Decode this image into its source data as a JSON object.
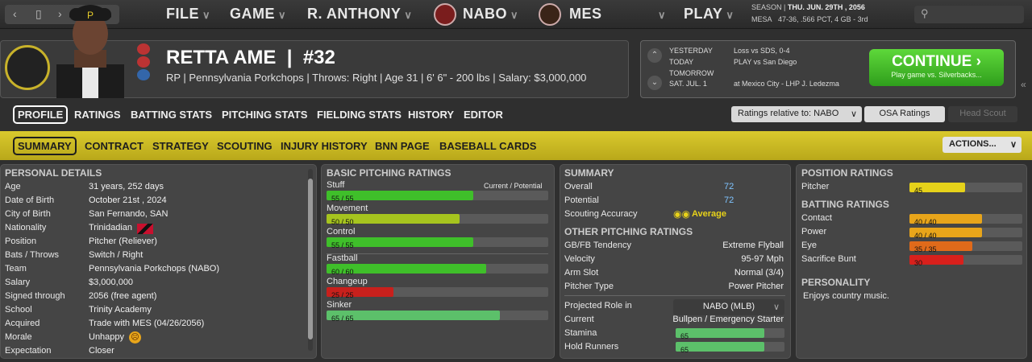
{
  "topbar": {
    "menus": [
      "FILE",
      "GAME",
      "R. ANTHONY",
      "NABO",
      "MES",
      "PLAY"
    ],
    "season_label": "SEASON",
    "season_date": "THU. JUN. 29TH , 2056",
    "team_code": "MESA",
    "team_record": "47-36, .566 PCT, 4 GB - 3rd"
  },
  "player": {
    "name": "RETTA AME",
    "number": "#32",
    "info": "RP | Pennsylvania Porkchops  |  Throws: Right  |  Age 31  |  6' 6\" - 200 lbs  |  Salary: $3,000,000"
  },
  "schedule": [
    {
      "day": "YESTERDAY",
      "event": "Loss vs SDS, 0-4"
    },
    {
      "day": "TODAY",
      "event": "PLAY vs San Diego"
    },
    {
      "day": "TOMORROW",
      "event": ""
    },
    {
      "day": "SAT. JUL. 1",
      "event": "at Mexico City - LHP J. Ledezma"
    }
  ],
  "continue_btn": {
    "label": "CONTINUE",
    "sub": "Play game vs. Silverbacks..."
  },
  "tabs": [
    "PROFILE",
    "RATINGS",
    "BATTING STATS",
    "PITCHING STATS",
    "FIELDING STATS",
    "HISTORY",
    "EDITOR"
  ],
  "ratings_relative": "Ratings relative to: NABO",
  "osa_ratings": "OSA Ratings",
  "head_scout": "Head Scout",
  "subtabs": [
    "SUMMARY",
    "CONTRACT",
    "STRATEGY",
    "SCOUTING",
    "INJURY HISTORY",
    "BNN PAGE",
    "BASEBALL CARDS"
  ],
  "actions": "ACTIONS...",
  "personal": {
    "title": "PERSONAL DETAILS",
    "rows": [
      {
        "k": "Age",
        "v": "31 years, 252 days"
      },
      {
        "k": "Date of Birth",
        "v": "October 21st , 2024"
      },
      {
        "k": "City of Birth",
        "v": "San Fernando, SAN"
      },
      {
        "k": "Nationality",
        "v": "Trinidadian"
      },
      {
        "k": "Position",
        "v": "Pitcher (Reliever)"
      },
      {
        "k": "Bats / Throws",
        "v": "Switch / Right"
      },
      {
        "k": "Team",
        "v": "Pennsylvania Porkchops (NABO)"
      },
      {
        "k": "Salary",
        "v": "$3,000,000"
      },
      {
        "k": "Signed through",
        "v": "2056 (free agent)"
      },
      {
        "k": "School",
        "v": "Trinity Academy"
      },
      {
        "k": "Acquired",
        "v": "Trade with MES (04/26/2056)"
      },
      {
        "k": "Morale",
        "v": "Unhappy"
      },
      {
        "k": "Expectation",
        "v": "Closer"
      }
    ]
  },
  "basic_pitching": {
    "title": "BASIC PITCHING RATINGS",
    "legend": "Current / Potential",
    "ratings": [
      {
        "name": "Stuff",
        "text": "55 / 55",
        "value": 55,
        "color": "#3fbf2a"
      },
      {
        "name": "Movement",
        "text": "50 / 50",
        "value": 50,
        "color": "#a6c41e"
      },
      {
        "name": "Control",
        "text": "55 / 55",
        "value": 55,
        "color": "#3fbf2a"
      }
    ],
    "pitches": [
      {
        "name": "Fastball",
        "text": "60 / 60",
        "value": 60,
        "color": "#3fbf2a"
      },
      {
        "name": "Changeup",
        "text": "25 / 25",
        "value": 25,
        "color": "#c8201c"
      },
      {
        "name": "Sinker",
        "text": "65 / 65",
        "value": 65,
        "color": "#5cc06a"
      }
    ]
  },
  "summary": {
    "title": "SUMMARY",
    "overall_label": "Overall",
    "overall": "72",
    "potential_label": "Potential",
    "potential": "72",
    "scouting_label": "Scouting Accuracy",
    "scouting": "Average",
    "other_title": "OTHER PITCHING RATINGS",
    "other": [
      {
        "k": "GB/FB Tendency",
        "v": "Extreme Flyball"
      },
      {
        "k": "Velocity",
        "v": "95-97 Mph"
      },
      {
        "k": "Arm Slot",
        "v": "Normal (3/4)"
      },
      {
        "k": "Pitcher Type",
        "v": "Power Pitcher"
      }
    ],
    "projected_label": "Projected Role in",
    "projected": "NABO (MLB)",
    "current_label": "Current",
    "current": "Bullpen / Emergency Starter",
    "stamina_label": "Stamina",
    "stamina": 65,
    "hold_label": "Hold Runners",
    "hold": 65
  },
  "position": {
    "title": "POSITION RATINGS",
    "pitcher_label": "Pitcher",
    "pitcher": 45,
    "batting_title": "BATTING RATINGS",
    "batting": [
      {
        "name": "Contact",
        "text": "40 / 40",
        "value": 40,
        "color": "#e8a51a"
      },
      {
        "name": "Power",
        "text": "40 / 40",
        "value": 40,
        "color": "#e8a51a"
      },
      {
        "name": "Eye",
        "text": "35 / 35",
        "value": 35,
        "color": "#e06a1a"
      },
      {
        "name": "Sacrifice Bunt",
        "text": "30",
        "value": 30,
        "color": "#d8201c"
      }
    ],
    "personality_title": "PERSONALITY",
    "personality": "Enjoys country music."
  }
}
